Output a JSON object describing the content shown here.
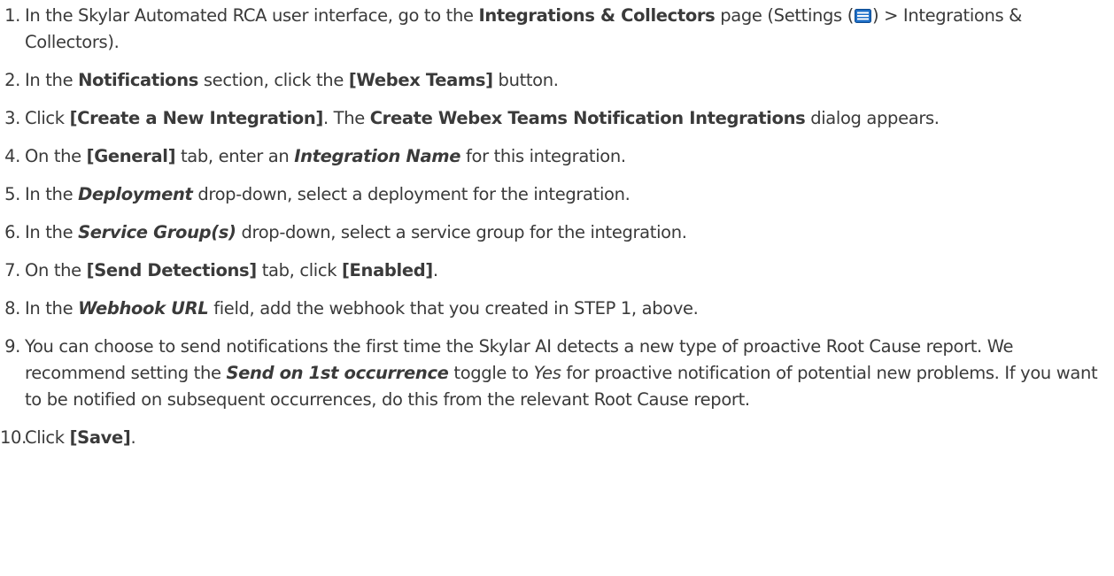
{
  "steps": [
    {
      "num": "1.",
      "parts": [
        {
          "t": "In the Skylar Automated RCA user interface, go to the ",
          "s": ""
        },
        {
          "t": "Integrations & Collectors",
          "s": "b"
        },
        {
          "t": " page (Settings (",
          "s": ""
        },
        {
          "icon": "menu-icon"
        },
        {
          "t": ") > Integrations & Collectors).",
          "s": ""
        }
      ]
    },
    {
      "num": "2.",
      "parts": [
        {
          "t": "In the ",
          "s": ""
        },
        {
          "t": "Notifications",
          "s": "b"
        },
        {
          "t": " section, click the ",
          "s": ""
        },
        {
          "t": "[Webex Teams]",
          "s": "b"
        },
        {
          "t": " button.",
          "s": ""
        }
      ]
    },
    {
      "num": "3.",
      "parts": [
        {
          "t": "Click ",
          "s": ""
        },
        {
          "t": "[Create a New Integration]",
          "s": "b"
        },
        {
          "t": ". The ",
          "s": ""
        },
        {
          "t": "Create Webex Teams Notification Integrations",
          "s": "b"
        },
        {
          "t": " dialog appears.",
          "s": ""
        }
      ]
    },
    {
      "num": "4.",
      "parts": [
        {
          "t": "On the ",
          "s": ""
        },
        {
          "t": "[General]",
          "s": "b"
        },
        {
          "t": " tab, enter an ",
          "s": ""
        },
        {
          "t": "Integration Name",
          "s": "bi"
        },
        {
          "t": " for this integration.",
          "s": ""
        }
      ]
    },
    {
      "num": "5.",
      "parts": [
        {
          "t": "In the ",
          "s": ""
        },
        {
          "t": "Deployment",
          "s": "bi"
        },
        {
          "t": " drop-down, select a deployment for the integration.",
          "s": ""
        }
      ]
    },
    {
      "num": "6.",
      "parts": [
        {
          "t": "In the ",
          "s": ""
        },
        {
          "t": "Service Group(s)",
          "s": "bi"
        },
        {
          "t": " drop-down, select a service group for the integration.",
          "s": ""
        }
      ]
    },
    {
      "num": "7.",
      "parts": [
        {
          "t": "On the ",
          "s": ""
        },
        {
          "t": "[Send Detections]",
          "s": "b"
        },
        {
          "t": " tab, click ",
          "s": ""
        },
        {
          "t": "[Enabled]",
          "s": "b"
        },
        {
          "t": ".",
          "s": ""
        }
      ]
    },
    {
      "num": "8.",
      "parts": [
        {
          "t": "In the ",
          "s": ""
        },
        {
          "t": "Webhook URL",
          "s": "bi"
        },
        {
          "t": " field, add the webhook that you created in STEP 1, above.",
          "s": ""
        }
      ]
    },
    {
      "num": "9.",
      "parts": [
        {
          "t": "You can choose to send notifications the first time the Skylar AI detects a new type of proactive Root Cause report. We recommend setting the ",
          "s": ""
        },
        {
          "t": "Send on 1st occurrence",
          "s": "bi"
        },
        {
          "t": " toggle to ",
          "s": ""
        },
        {
          "t": "Yes",
          "s": "i"
        },
        {
          "t": " for proactive notification of potential new problems. If you want to be notified on subsequent occurrences, do this from the relevant Root Cause report.",
          "s": ""
        }
      ]
    },
    {
      "num": "10.",
      "parts": [
        {
          "t": "Click ",
          "s": ""
        },
        {
          "t": "[Save]",
          "s": "b"
        },
        {
          "t": ".",
          "s": ""
        }
      ]
    }
  ],
  "colors": {
    "text": "#3a3a3a",
    "icon_fill": "#1e6fc7",
    "icon_stroke": "#0d4a8f"
  }
}
